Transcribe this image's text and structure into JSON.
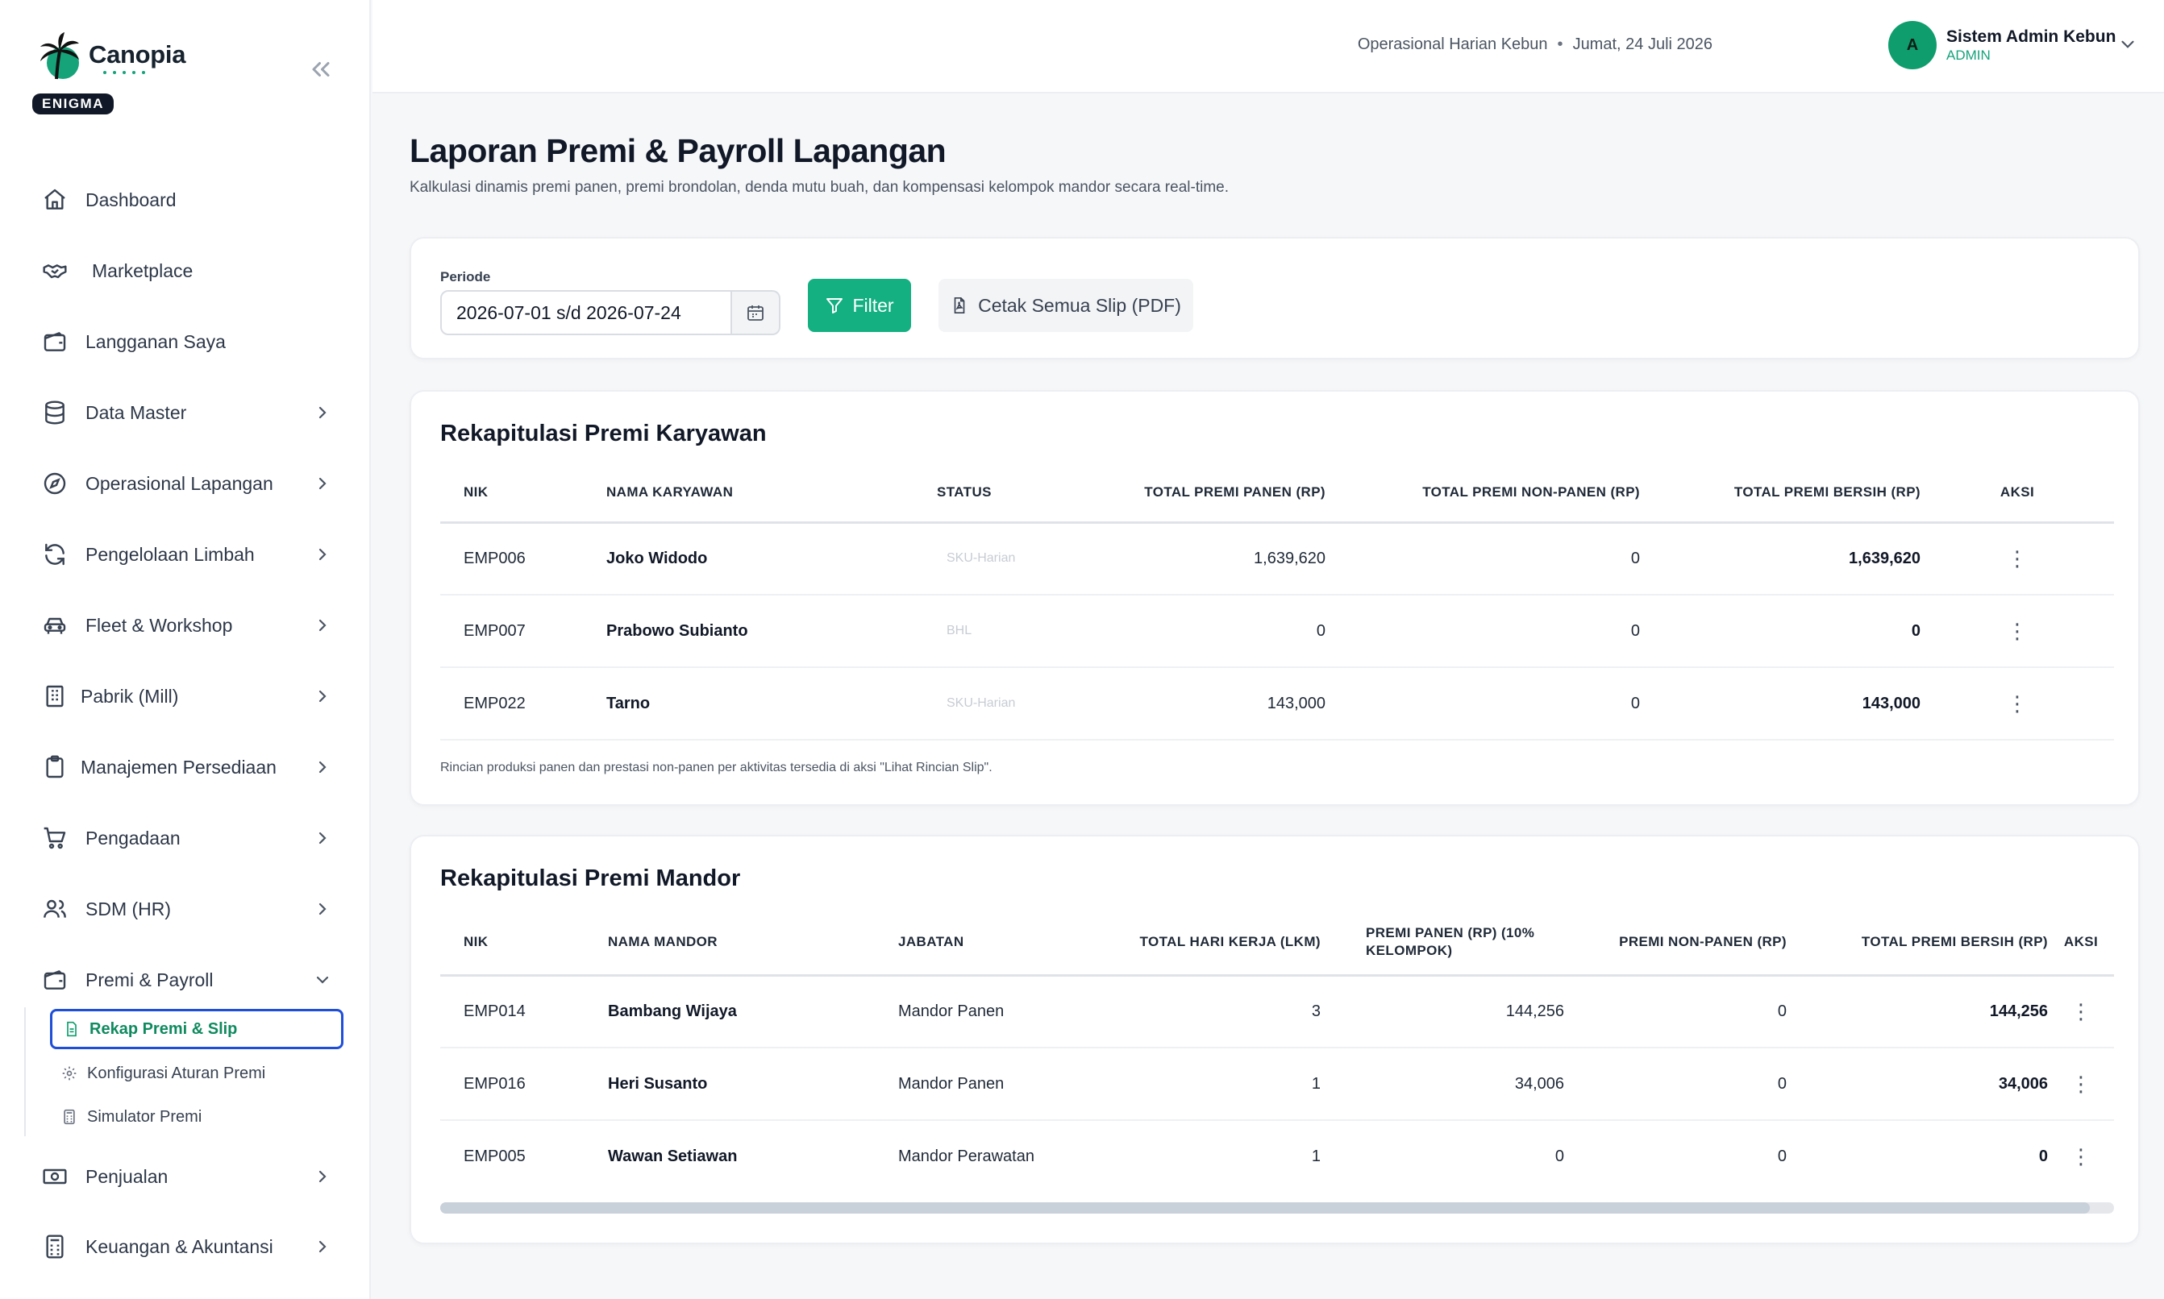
{
  "brand": {
    "name": "Canopia",
    "badge": "ENIGMA"
  },
  "sidebar": {
    "items": [
      {
        "label": "Dashboard",
        "icon": "home-icon"
      },
      {
        "label": "Marketplace",
        "icon": "handshake-icon"
      },
      {
        "label": "Langganan Saya",
        "icon": "wallet-icon"
      },
      {
        "label": "Data Master",
        "icon": "database-icon"
      },
      {
        "label": "Operasional Lapangan",
        "icon": "compass-icon"
      },
      {
        "label": "Pengelolaan Limbah",
        "icon": "recycle-icon"
      },
      {
        "label": "Fleet & Workshop",
        "icon": "car-icon"
      },
      {
        "label": "Pabrik (Mill)",
        "icon": "building-icon"
      },
      {
        "label": "Manajemen Persediaan",
        "icon": "clipboard-icon"
      },
      {
        "label": "Pengadaan",
        "icon": "cart-icon"
      },
      {
        "label": "SDM (HR)",
        "icon": "users-icon"
      },
      {
        "label": "Premi & Payroll",
        "icon": "wallet-icon"
      },
      {
        "label": "Penjualan",
        "icon": "cash-icon"
      },
      {
        "label": "Keuangan & Akuntansi",
        "icon": "calculator-icon"
      }
    ],
    "sub_items": [
      {
        "label": "Rekap Premi & Slip",
        "active": true
      },
      {
        "label": "Konfigurasi Aturan Premi",
        "active": false
      },
      {
        "label": "Simulator Premi",
        "active": false
      }
    ]
  },
  "header": {
    "context": "Operasional Harian Kebun",
    "date": "Jumat, 24 Juli 2026",
    "avatar_initial": "A",
    "user_name": "Sistem Admin Kebun",
    "user_role": "ADMIN"
  },
  "page": {
    "title": "Laporan Premi & Payroll Lapangan",
    "subtitle": "Kalkulasi dinamis premi panen, premi brondolan, denda mutu buah, dan kompensasi kelompok mandor secara real-time."
  },
  "filter": {
    "periode_label": "Periode",
    "periode_value": "2026-07-01 s/d 2026-07-24",
    "filter_label": "Filter",
    "print_label": "Cetak Semua Slip (PDF)"
  },
  "employee_table": {
    "title": "Rekapitulasi Premi Karyawan",
    "headers": [
      "NIK",
      "NAMA KARYAWAN",
      "STATUS",
      "TOTAL PREMI PANEN (RP)",
      "TOTAL PREMI NON-PANEN (RP)",
      "TOTAL PREMI BERSIH (RP)",
      "AKSI"
    ],
    "rows": [
      {
        "nik": "EMP006",
        "nama": "Joko Widodo",
        "status": "SKU-Harian",
        "panen": "1,639,620",
        "non_panen": "0",
        "bersih": "1,639,620"
      },
      {
        "nik": "EMP007",
        "nama": "Prabowo Subianto",
        "status": "BHL",
        "panen": "0",
        "non_panen": "0",
        "bersih": "0"
      },
      {
        "nik": "EMP022",
        "nama": "Tarno",
        "status": "SKU-Harian",
        "panen": "143,000",
        "non_panen": "0",
        "bersih": "143,000"
      }
    ],
    "note": "Rincian produksi panen dan prestasi non-panen per aktivitas tersedia di aksi \"Lihat Rincian Slip\"."
  },
  "mandor_table": {
    "title": "Rekapitulasi Premi Mandor",
    "headers": [
      "NIK",
      "NAMA MANDOR",
      "JABATAN",
      "TOTAL HARI KERJA (LKM)",
      "PREMI PANEN (RP) (10% KELOMPOK)",
      "PREMI NON-PANEN (RP)",
      "TOTAL PREMI BERSIH (RP)",
      "AKSI"
    ],
    "rows": [
      {
        "nik": "EMP014",
        "nama": "Bambang Wijaya",
        "jabatan": "Mandor Panen",
        "hari": "3",
        "panen": "144,256",
        "non_panen": "0",
        "bersih": "144,256"
      },
      {
        "nik": "EMP016",
        "nama": "Heri Susanto",
        "jabatan": "Mandor Panen",
        "hari": "1",
        "panen": "34,006",
        "non_panen": "0",
        "bersih": "34,006"
      },
      {
        "nik": "EMP005",
        "nama": "Wawan Setiawan",
        "jabatan": "Mandor Perawatan",
        "hari": "1",
        "panen": "0",
        "non_panen": "0",
        "bersih": "0"
      }
    ]
  },
  "colors": {
    "accent": "#14b082",
    "active_border": "#1f4fd8",
    "text": "#111827"
  }
}
